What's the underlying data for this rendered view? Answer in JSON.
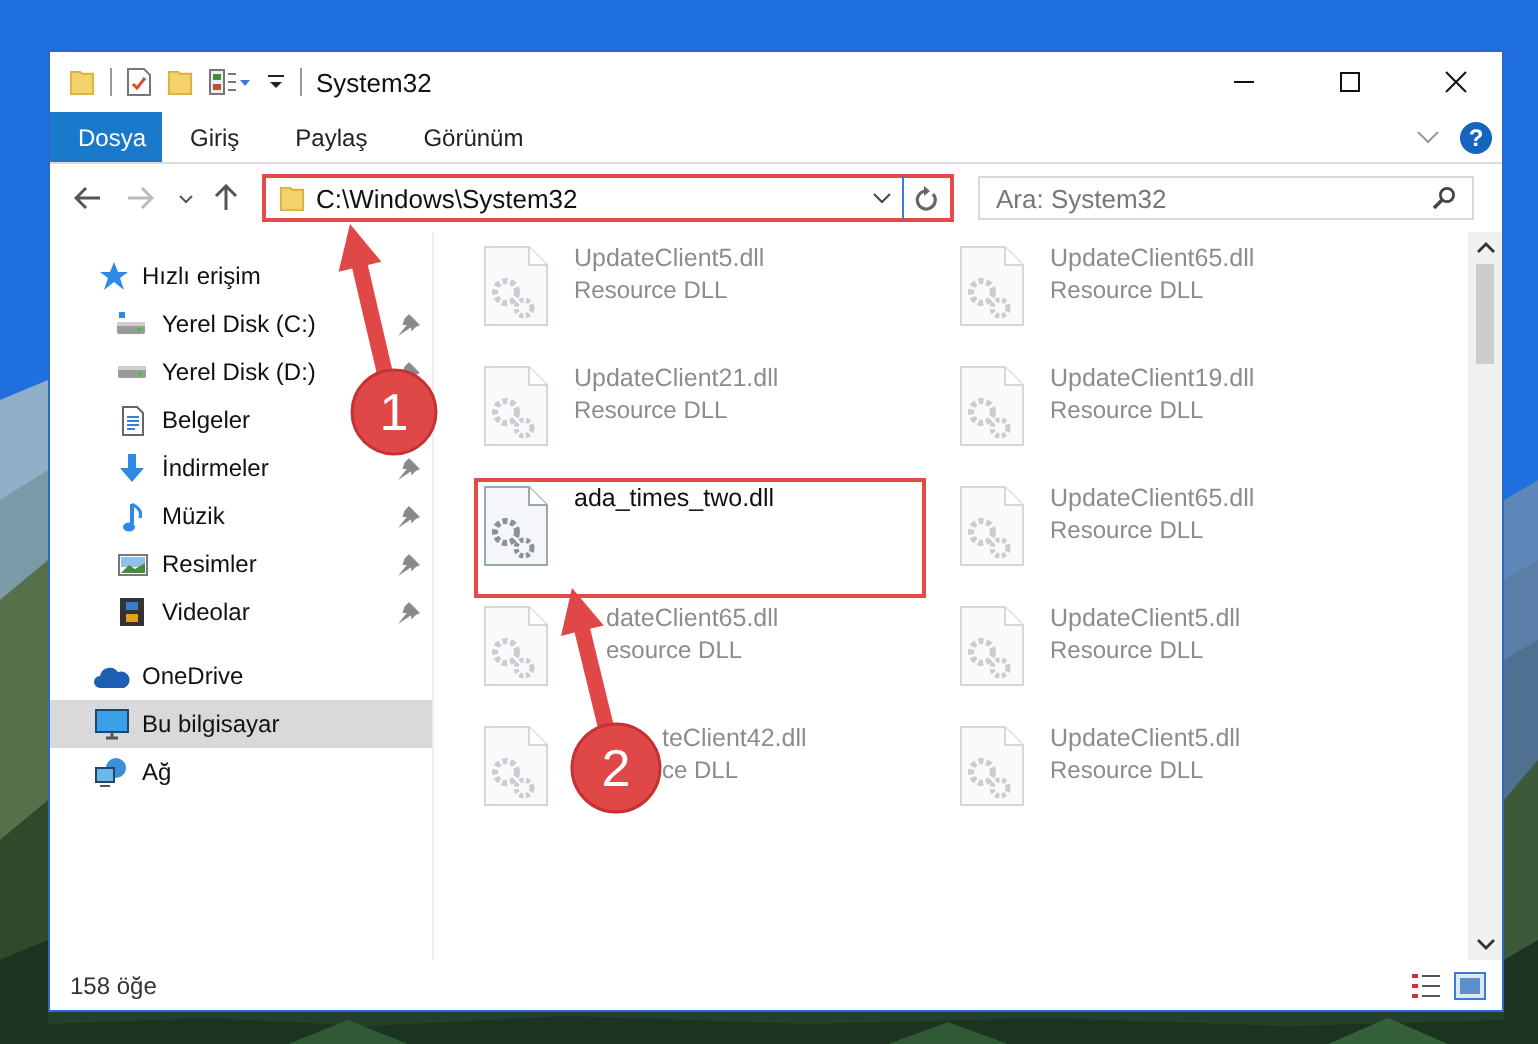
{
  "window": {
    "title": "System32"
  },
  "ribbon": {
    "tabs": [
      {
        "label": "Dosya",
        "selected": true
      },
      {
        "label": "Giriş",
        "selected": false
      },
      {
        "label": "Paylaş",
        "selected": false
      },
      {
        "label": "Görünüm",
        "selected": false
      }
    ],
    "help": "?"
  },
  "address_bar": {
    "path": "C:\\Windows\\System32",
    "highlighted": true
  },
  "search": {
    "placeholder": "Ara: System32"
  },
  "sidebar": {
    "items": [
      {
        "label": "Hızlı erişim",
        "kind": "star",
        "selected": false,
        "children": [
          {
            "label": "Yerel Disk (C:)",
            "kind": "drive-windows",
            "pinned": true
          },
          {
            "label": "Yerel Disk (D:)",
            "kind": "drive",
            "pinned": true
          },
          {
            "label": "Belgeler",
            "kind": "documents",
            "pinned": false
          },
          {
            "label": "İndirmeler",
            "kind": "download",
            "pinned": true
          },
          {
            "label": "Müzik",
            "kind": "music",
            "pinned": true
          },
          {
            "label": "Resimler",
            "kind": "pictures",
            "pinned": true
          },
          {
            "label": "Videolar",
            "kind": "videos",
            "pinned": true
          }
        ]
      },
      {
        "label": "OneDrive",
        "kind": "cloud",
        "selected": false
      },
      {
        "label": "Bu bilgisayar",
        "kind": "computer",
        "selected": true
      },
      {
        "label": "Ağ",
        "kind": "network",
        "selected": false
      }
    ]
  },
  "files": [
    {
      "name": "UpdateClient5.dll",
      "type": "Resource DLL",
      "faded": true,
      "highlighted": false,
      "kind": "plain"
    },
    {
      "name": "UpdateClient65.dll",
      "type": "Resource DLL",
      "faded": true,
      "highlighted": false,
      "kind": "plain"
    },
    {
      "name": "UpdateClient21.dll",
      "type": "Resource DLL",
      "faded": true,
      "highlighted": false,
      "kind": "plain"
    },
    {
      "name": "UpdateClient19.dll",
      "type": "Resource DLL",
      "faded": true,
      "highlighted": false,
      "kind": "plain"
    },
    {
      "name": "ada_times_two.dll",
      "faded": false,
      "highlighted": true,
      "kind": "plain"
    },
    {
      "name": "UpdateClient65.dll",
      "type": "Resource DLL",
      "faded": true,
      "highlighted": false,
      "kind": "plain"
    },
    {
      "name": "dateClient65.dll",
      "type": "esource DLL",
      "faded": true,
      "highlighted": false,
      "kind": "under-arrow"
    },
    {
      "name": "UpdateClient5.dll",
      "type": "Resource DLL",
      "faded": true,
      "highlighted": false,
      "kind": "plain"
    },
    {
      "name": "teClient42.dll",
      "type": "ce DLL",
      "faded": true,
      "highlighted": false,
      "kind": "under-badge"
    },
    {
      "name": "UpdateClient5.dll",
      "type": "Resource DLL",
      "faded": true,
      "highlighted": false,
      "kind": "plain"
    }
  ],
  "status_bar": {
    "item_count": "158 öğe"
  },
  "markers": [
    {
      "label": "1"
    },
    {
      "label": "2"
    }
  ]
}
